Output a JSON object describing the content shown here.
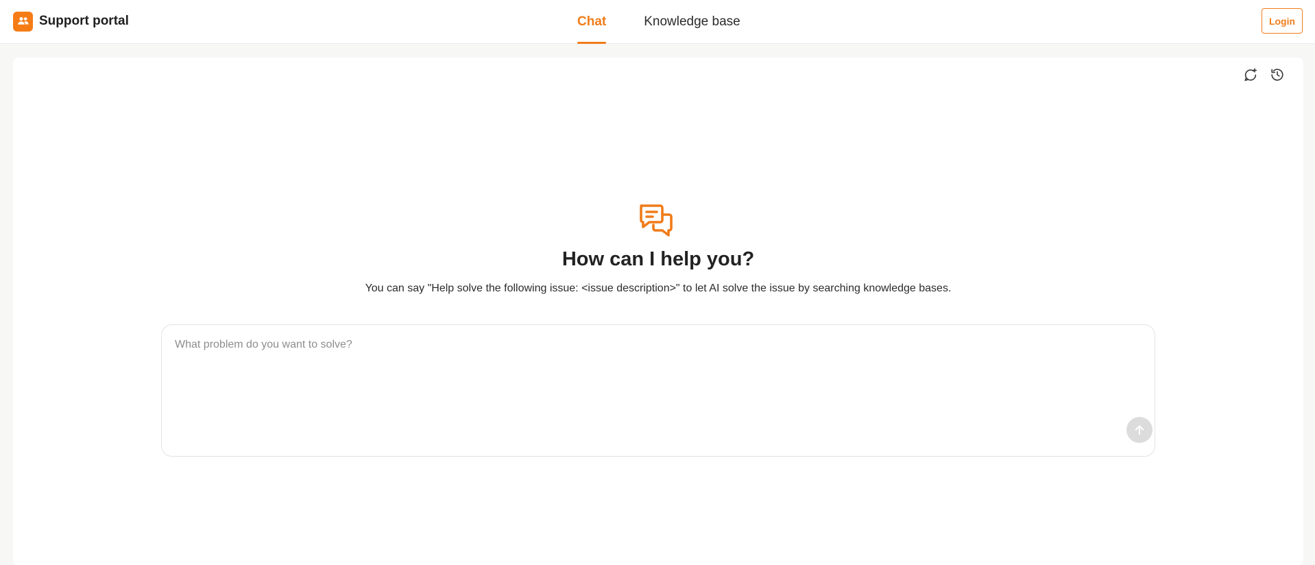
{
  "app": {
    "name": "Support portal",
    "accent_color": "#f07c19",
    "logo_icon": "users-icon"
  },
  "nav": {
    "tabs": [
      {
        "label": "Chat",
        "active": true
      },
      {
        "label": "Knowledge base",
        "active": false
      }
    ],
    "login_label": "Login"
  },
  "panel": {
    "tools": [
      "new-chat-icon",
      "history-icon"
    ]
  },
  "hero": {
    "icon": "chat-bubbles-icon",
    "title": "How can I help you?",
    "subtitle": "You can say \"Help solve the following issue: <issue description>\" to let AI solve the issue by searching knowledge bases."
  },
  "composer": {
    "placeholder": "What problem do you want to solve?",
    "value": "",
    "send_icon": "arrow-up-icon"
  }
}
